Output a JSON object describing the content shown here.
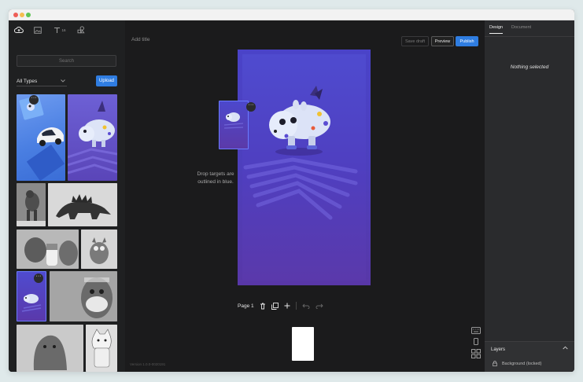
{
  "left_panel": {
    "tabs": [
      {
        "name": "upload-cloud-icon"
      },
      {
        "name": "image-icon"
      },
      {
        "name": "text-icon",
        "badge": "16"
      },
      {
        "name": "shapes-icon"
      }
    ],
    "search_placeholder": "Search",
    "type_filter": "All Types",
    "upload_label": "Upload"
  },
  "editor": {
    "title_placeholder": "Add title",
    "save_draft_label": "Save draft",
    "preview_label": "Preview",
    "publish_label": "Publish",
    "drop_hint": "Drop targets are outlined in blue.",
    "page_label": "Page 1",
    "version": "Version 1.0.0-0020191"
  },
  "right_panel": {
    "tabs": [
      "Design",
      "Document"
    ],
    "active_tab": "Design",
    "empty_state": "Nothing selected",
    "layers_title": "Layers",
    "layer_item": "Background (locked)"
  },
  "colors": {
    "accent": "#2f7de1",
    "canvas_gradient_top": "#4a43c8",
    "canvas_gradient_bottom": "#5837a7"
  }
}
